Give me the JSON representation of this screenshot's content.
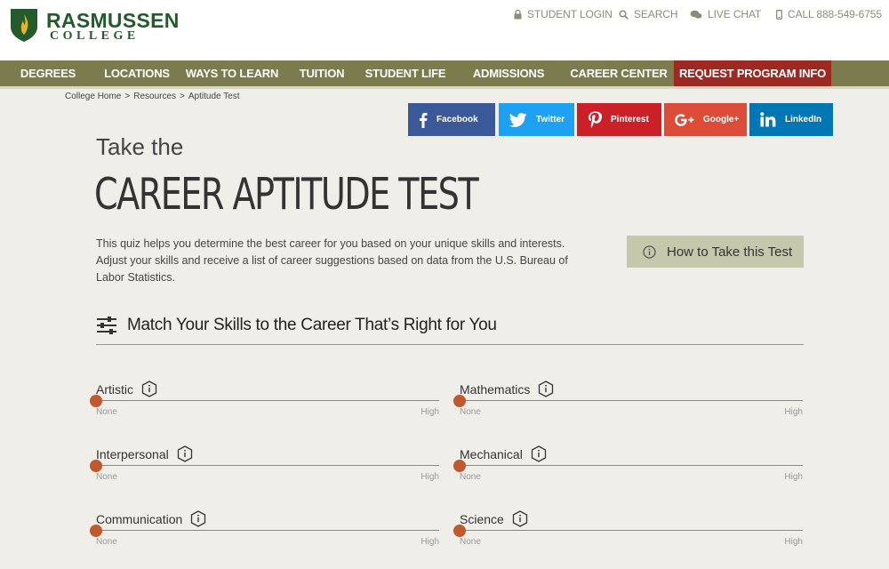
{
  "brand": {
    "name": "RASMUSSEN",
    "sub": "COLLEGE"
  },
  "utility": {
    "login": "STUDENT LOGIN",
    "search": "SEARCH",
    "chat": "LIVE CHAT",
    "call": "CALL 888-549-6755"
  },
  "nav": {
    "items": [
      "DEGREES",
      "LOCATIONS",
      "WAYS TO LEARN",
      "TUITION",
      "STUDENT LIFE",
      "ADMISSIONS",
      "CAREER CENTER"
    ],
    "cta": "REQUEST PROGRAM INFO"
  },
  "breadcrumb": {
    "home": "College Home",
    "resources": "Resources",
    "current": "Aptitude Test",
    "sep": ">"
  },
  "social": {
    "facebook": "Facebook",
    "twitter": "Twitter",
    "pinterest": "Pinterest",
    "googleplus": "Google+",
    "linkedin": "LinkedIn"
  },
  "page": {
    "pre_title": "Take the",
    "title": "CAREER APTITUDE TEST",
    "intro": "This quiz helps you determine the best career for you based on your unique skills and interests. Adjust your skills and receive a list of career suggestions based on data from the U.S. Bureau of Labor Statistics.",
    "howto": "How to Take this Test",
    "section_heading": "Match Your Skills to the Career That’s Right for You"
  },
  "skills": {
    "min_label": "None",
    "max_label": "High",
    "items": [
      {
        "label": "Artistic",
        "value": 0
      },
      {
        "label": "Mathematics",
        "value": 0
      },
      {
        "label": "Interpersonal",
        "value": 0
      },
      {
        "label": "Mechanical",
        "value": 0
      },
      {
        "label": "Communication",
        "value": 0
      },
      {
        "label": "Science",
        "value": 0
      }
    ]
  },
  "colors": {
    "brand_green": "#235b2c",
    "nav_olive": "#7b7b4e",
    "cta_red": "#9c2a22",
    "slider_thumb": "#c0592d",
    "howto_bg": "#c5c8ab"
  }
}
